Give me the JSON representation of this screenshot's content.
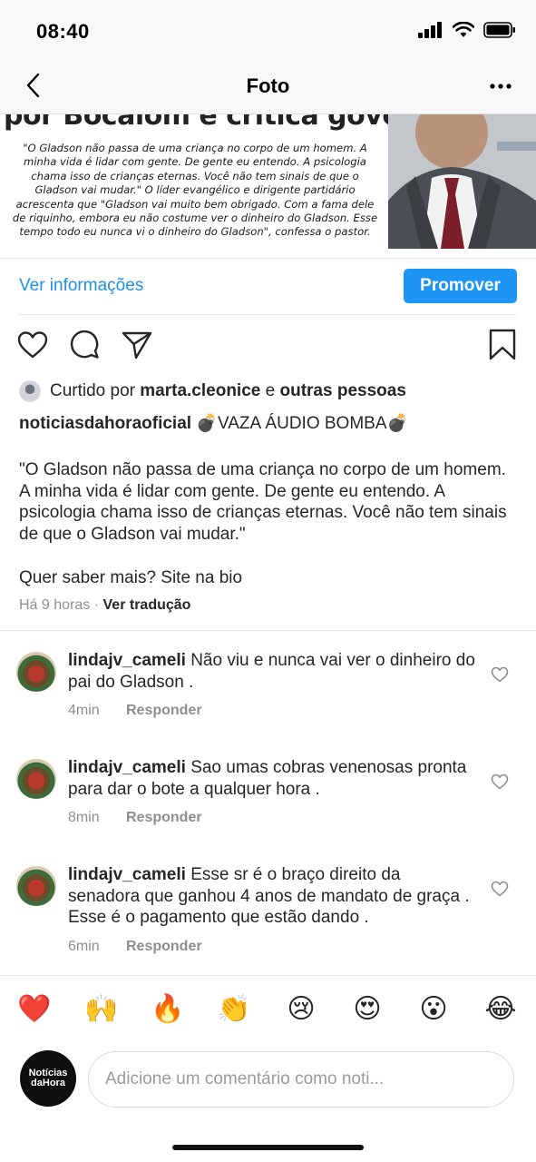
{
  "status_bar": {
    "time": "08:40"
  },
  "header": {
    "title": "Foto"
  },
  "photo": {
    "headline": "por Bocalom e critica governo",
    "quote": "\"O Gladson não passa de uma criança no corpo de um homem. A minha vida é lidar com gente. De gente eu entendo. A psicologia chama isso de crianças eternas. Você não tem sinais de que o Gladson vai mudar.\" O líder evangélico e dirigente partidário acrescenta que \"Gladson vai muito bem obrigado. Com a fama dele de riquinho, embora eu não costume ver o dinheiro do Gladson. Esse tempo todo eu nunca vi o dinheiro do Gladson\", confessa o pastor."
  },
  "insights": {
    "info_label": "Ver informações",
    "promote_label": "Promover"
  },
  "likes": {
    "prefix": "Curtido por",
    "user": "marta.cleonice",
    "connector": "e",
    "others": "outras pessoas"
  },
  "caption": {
    "username": "noticiasdahoraoficial",
    "headline": "💣VAZA ÁUDIO BOMBA💣",
    "body": "\"O Gladson não passa de uma criança no corpo de um homem. A minha vida é lidar com gente. De gente eu entendo. A psicologia chama isso de crianças eternas. Você não tem sinais de que o Gladson vai mudar.\"",
    "more": "Quer saber mais? Site na bio",
    "time": "Há 9 horas",
    "dot": "·",
    "translate": "Ver tradução"
  },
  "comments": [
    {
      "user": "lindajv_cameli",
      "text": "Não viu e nunca vai ver o dinheiro do pai do Gladson .",
      "time": "4min",
      "reply": "Responder"
    },
    {
      "user": "lindajv_cameli",
      "text": "Sao umas cobras venenosas pronta para dar o bote a qualquer hora .",
      "time": "8min",
      "reply": "Responder"
    },
    {
      "user": "lindajv_cameli",
      "text": "Esse sr é o braço direito da senadora que ganhou 4 anos de mandato de graça .  Esse é o pagamento que estão dando .",
      "time": "6min",
      "reply": "Responder"
    }
  ],
  "emoji_bar": [
    "❤️",
    "🙌",
    "🔥",
    "👏",
    "😢",
    "😍",
    "😮",
    "😂"
  ],
  "composer": {
    "avatar_line1": "Notícias",
    "avatar_line2": "daHora",
    "placeholder": "Adicione um comentário como noti..."
  },
  "colors": {
    "accent": "#1e95f4",
    "link": "#1c8ff0",
    "muted": "#8e8e8e"
  }
}
